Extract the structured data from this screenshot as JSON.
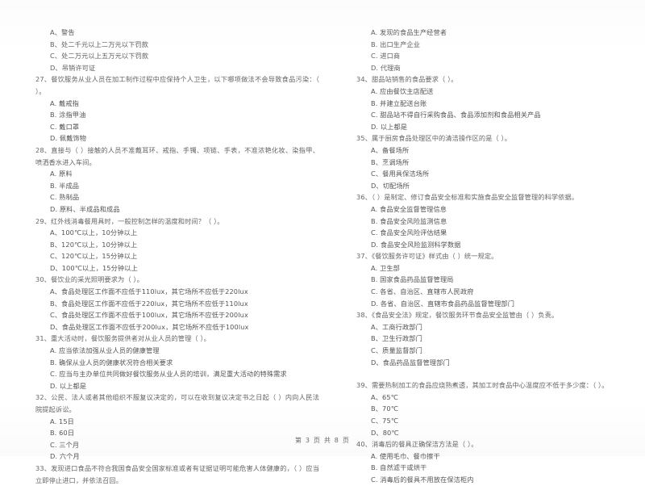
{
  "document": {
    "footer_prefix": "第",
    "footer_page": "3",
    "footer_middle": "页  共",
    "footer_total": "8",
    "footer_suffix": "页",
    "footer_full": "第 3 页  共 8 页"
  },
  "left_column": {
    "carryover_options": [
      "A、警告",
      "B、处二千元以上二万元以下罚款",
      "C、处二万元以上五万元以下罚款",
      "D、吊销许可证"
    ],
    "questions": [
      {
        "number": "27、",
        "stem": "餐饮服务从业人员在加工制作过程中应保持个人卫生，以下哪项做法不会导致食品污染：（      ）。",
        "options": [
          "A. 戴戒指",
          "B. 涂指甲油",
          "C. 戴口罩",
          "D. 佩戴饰物"
        ]
      },
      {
        "number": "28、",
        "stem": "直接与（        ）接触的人员不准戴耳环、戒指、手镯、项链、手表，不准浓艳化妆、染指甲、喷洒香水进入车间。",
        "options": [
          "A. 原料",
          "B. 半成品",
          "C. 熟制品",
          "D. 原料、半成品和成品"
        ]
      },
      {
        "number": "29、",
        "stem": "红外线消毒餐用具时，一般控制怎样的温度和时间？（      ）。",
        "options": [
          "A、100℃以上，10分钟以上",
          "B、120℃以上，10分钟以上",
          "C、120℃以上，15分钟以上",
          "D、100℃以上，15分钟以上"
        ]
      },
      {
        "number": "30、",
        "stem": "餐饮业的采光照明要求为（      ）。",
        "options": [
          "A、食品处理区工作面不应低于110lux，其它场所不应低于220lux",
          "B、食品处理区工作面不应低于220lux，其它场所不应低于110lux",
          "C、食品处理区工作面不应低于100lux，其它场所不应低于200lux",
          "D、食品处理区工作面不应低于200lux，其它场所不应低于100lux"
        ]
      },
      {
        "number": "31、",
        "stem": "重大活动时，餐饮服务提供者对从业人员的管理（      ）。",
        "options": [
          "A. 应当依法加强从业人员的健康管理",
          "B. 确保从业人员的健康状况符合相关要求",
          "C. 应当与主办单位共同做好餐饮服务从业人员的培训，满足重大活动的特殊需求",
          "D. 以上都是"
        ]
      },
      {
        "number": "32、",
        "stem": "公民、法人或者其他组织不服复议决定的，可以在收到复议决定书之日起（        ）内向人民法院提起诉讼。",
        "options": [
          "A. 15日",
          "B. 60日",
          "C. 三个月",
          "D. 六个月"
        ]
      },
      {
        "number": "33、",
        "stem": "发现进口食品不符合我国食品安全国家标准或者有证据证明可能危害人体健康的，（      ）应当立即停止进口，并依法召回。",
        "options": []
      }
    ]
  },
  "right_column": {
    "carryover_options": [
      "A. 发现的食品生产经营者",
      "B. 出口生产企业",
      "C. 进口商",
      "D. 代理商"
    ],
    "questions": [
      {
        "number": "34、",
        "stem": "甜品站销售的食品要求（      ）。",
        "options": [
          "A. 应由餐饮主店配送",
          "B. 并建立配送台账",
          "C. 甜品站不得自行采购食品、食品添加剂和食品相关产品",
          "D. 以上都是"
        ]
      },
      {
        "number": "35、",
        "stem": "属于厨房食品处理区中的清洁操作区的是（      ）。",
        "options": [
          "A、备餐场所",
          "B、烹调场所",
          "C、餐用具保洁场所",
          "D、切配场所"
        ]
      },
      {
        "number": "36、",
        "stem": "（      ）是制定、修订食品安全标准和实施食品安全监督管理的科学依据。",
        "options": [
          "A. 食品安全监督管理信息",
          "B. 食品安全风险监测信息",
          "C. 食品安全风险评估结果",
          "D. 食品安全风险监测科学数据"
        ]
      },
      {
        "number": "37、",
        "stem": "《餐饮服务许可证》样式由（      ）统一规定。",
        "options": [
          "A. 卫生部",
          "B. 国家食品药品监督管理局",
          "C. 各省、自治区、直辖市人民政府",
          "D. 各省、自治区、直辖市食品药品监督管理部门"
        ]
      },
      {
        "number": "38、",
        "stem": "《食品安全法》规定，餐饮服务环节食品安全监管由（      ）负责。",
        "options": [
          "A、工商行政部门",
          "B、卫生行政部门",
          "C、质量监督部门",
          "D、食品药品监督管理部门"
        ]
      },
      {
        "number": "39、",
        "stem": "需要热制加工的食品应烧熟煮透，其加工时食品中心温度应不低于多少度：（      ）。",
        "options": [
          "A、65℃",
          "B、70℃",
          "C、75℃",
          "D、80℃"
        ]
      },
      {
        "number": "40、",
        "stem": "消毒后的餐具正确保洁方法是（      ）。",
        "options": [
          "A. 使用毛巾、餐巾擦干",
          "B. 自然滤干或烘干",
          "C. 消毒后的餐具不用放在保洁柜内"
        ]
      }
    ]
  }
}
